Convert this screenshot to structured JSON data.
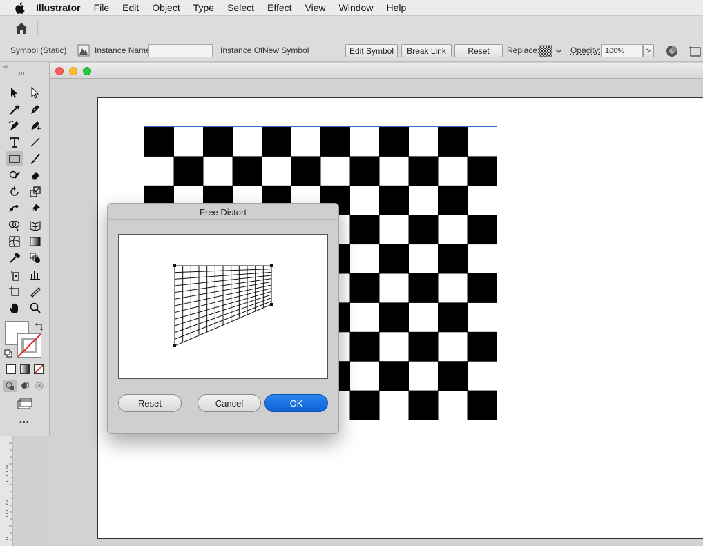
{
  "menubar": {
    "apple_icon": "apple-icon",
    "items": [
      "Illustrator",
      "File",
      "Edit",
      "Object",
      "Type",
      "Select",
      "Effect",
      "View",
      "Window",
      "Help"
    ]
  },
  "appbar": {
    "home_icon": "home-icon"
  },
  "controlbar": {
    "selection_type": "Symbol (Static)",
    "instance_name_label": "Instance Name:",
    "instance_name_value": "",
    "instance_of_label": "Instance Of:",
    "instance_of_value": "New Symbol",
    "edit_symbol": "Edit Symbol",
    "break_link": "Break Link",
    "reset": "Reset",
    "replace_label": "Replace:",
    "opacity_label": "Opacity:",
    "opacity_value": "100%",
    "more_arrow": ">"
  },
  "toolpanel": {
    "collapse_glyph": "‹‹",
    "more_glyph": "•••",
    "selected_tool": "rectangle-tool"
  },
  "ruler": {
    "labels": [
      "1",
      "0",
      "0",
      "2",
      "0",
      "0",
      "3"
    ]
  },
  "document": {
    "colors": {
      "close": "#fc5f57",
      "minimize": "#fdbc2e",
      "zoom": "#28c840",
      "selection": "#2a6fcf"
    }
  },
  "dialog": {
    "title": "Free Distort",
    "reset": "Reset",
    "cancel": "Cancel",
    "ok": "OK"
  }
}
